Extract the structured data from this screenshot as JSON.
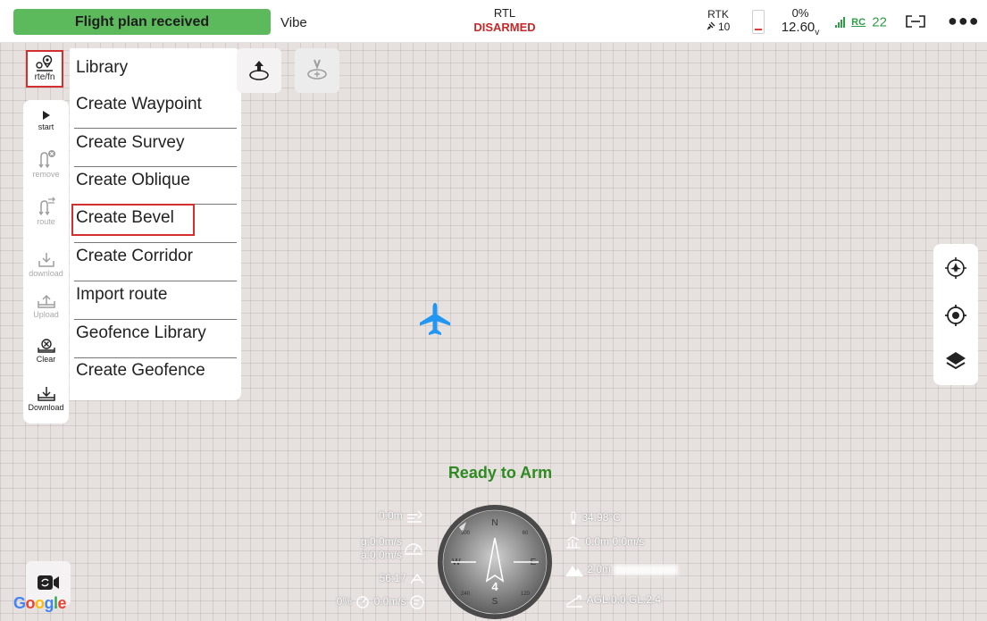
{
  "topbar": {
    "status_message": "Flight plan received",
    "status_color": "#5cba5c",
    "vehicle_name": "Vibe",
    "flight_mode": "RTL",
    "arm_state": "DISARMED",
    "rtk_label": "RTK",
    "rtk_sat_count": "10",
    "battery_percent": "0%",
    "battery_voltage": "12.60",
    "battery_voltage_unit": "v",
    "rc_label": "RC",
    "rc_value": "22",
    "more_icon": "more-horizontal-icon"
  },
  "left_toolbar": {
    "route_fn_label": "rte/fn",
    "items": [
      {
        "label": "start",
        "icon": "play-icon",
        "enabled": true
      },
      {
        "label": "remove",
        "icon": "remove-route-icon",
        "enabled": false
      },
      {
        "label": "route",
        "icon": "route-icon",
        "enabled": false
      },
      {
        "label": "download",
        "icon": "download-icon",
        "enabled": false
      },
      {
        "label": "Upload",
        "icon": "upload-icon",
        "enabled": false
      },
      {
        "label": "Clear",
        "icon": "clear-icon",
        "enabled": true
      },
      {
        "label": "Download",
        "icon": "download-tray-icon",
        "enabled": true
      }
    ]
  },
  "route_menu": {
    "items": [
      "Library",
      "Create Waypoint",
      "Create Survey",
      "Create Oblique",
      "Create Bevel",
      "Create Corridor",
      "Import route",
      "Geofence Library",
      "Create Geofence"
    ]
  },
  "map": {
    "ready_message": "Ready to Arm",
    "google_logo": "Google"
  },
  "telemetry": {
    "altitude": "0.0m",
    "ground_speed": "g:0.0m/s",
    "air_speed": "a:0.0m/s",
    "flight_time": "56:17",
    "throttle": "0%",
    "wind_speed": "0.0m/s",
    "temperature": "34.98°C",
    "climb_rate": "0.0m 0.0m/s",
    "distance": "2.0m",
    "agl": "AGL:0.0 GL:2.4"
  },
  "compass": {
    "N": "N",
    "E": "E",
    "S": "S",
    "W": "W",
    "ticks": [
      "60",
      "120",
      "240",
      "300"
    ],
    "center_value": "4"
  },
  "colors": {
    "accent_green": "#2e8b22",
    "alert_red": "#d32f2f",
    "plane_blue": "#2196f3"
  }
}
